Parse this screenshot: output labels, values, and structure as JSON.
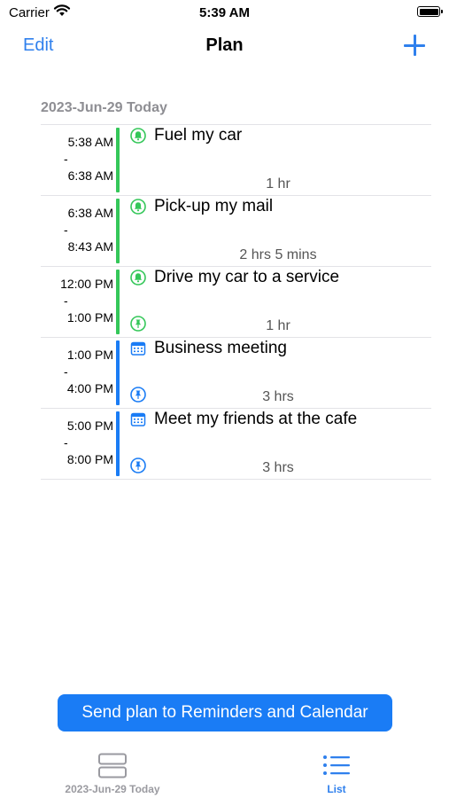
{
  "status_bar": {
    "carrier": "Carrier",
    "time": "5:39 AM"
  },
  "nav": {
    "edit_label": "Edit",
    "title": "Plan",
    "add_icon": "plus-icon"
  },
  "section": {
    "header": "2023-Jun-29 Today"
  },
  "colors": {
    "accent": "#2f80ed",
    "reminder": "#34c759",
    "calendar": "#1a7cf5",
    "button": "#1a7cf5"
  },
  "items": [
    {
      "start": "5:38 AM",
      "dash": "-",
      "end": "6:38 AM",
      "title": "Fuel my car",
      "duration": "1 hr",
      "type": "reminder",
      "type_icon": "bell-icon",
      "pinned": false
    },
    {
      "start": "6:38 AM",
      "dash": "-",
      "end": "8:43 AM",
      "title": "Pick-up my mail",
      "duration": "2 hrs 5 mins",
      "type": "reminder",
      "type_icon": "bell-icon",
      "pinned": false
    },
    {
      "start": "12:00 PM",
      "dash": "-",
      "end": "1:00 PM",
      "title": "Drive my car to a service",
      "duration": "1 hr",
      "type": "reminder",
      "type_icon": "bell-icon",
      "pinned": true
    },
    {
      "start": "1:00 PM",
      "dash": "-",
      "end": "4:00 PM",
      "title": "Business meeting",
      "duration": "3 hrs",
      "type": "calendar",
      "type_icon": "calendar-icon",
      "pinned": true
    },
    {
      "start": "5:00 PM",
      "dash": "-",
      "end": "8:00 PM",
      "title": "Meet my friends at the cafe",
      "duration": "3 hrs",
      "type": "calendar",
      "type_icon": "calendar-icon",
      "pinned": true
    }
  ],
  "send_button_label": "Send plan to Reminders and Calendar",
  "tabs": [
    {
      "label": "2023-Jun-29 Today",
      "icon": "day-view-icon",
      "selected": false
    },
    {
      "label": "List",
      "icon": "list-icon",
      "selected": true
    }
  ]
}
